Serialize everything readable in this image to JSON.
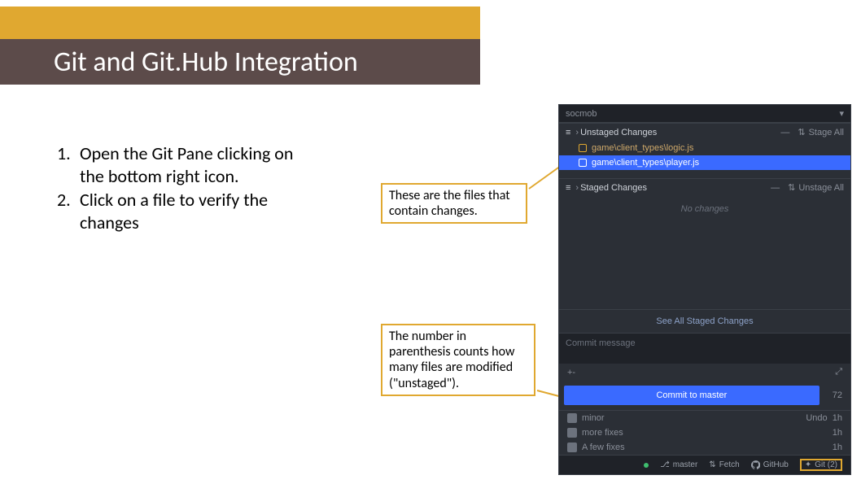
{
  "slide": {
    "title": "Git and Git.Hub Integration"
  },
  "instructions": [
    {
      "num": "1.",
      "text": "Open the Git Pane clicking on the bottom right icon."
    },
    {
      "num": "2.",
      "text": "Click on a file to verify the changes"
    }
  ],
  "callouts": {
    "files": "These are the files that contain changes.",
    "count": "The number in parenthesis counts how many files are modified (\"unstaged\")."
  },
  "git": {
    "project": "socmob",
    "sections": {
      "unstaged": {
        "label": "Unstaged Changes",
        "stage_all": "Stage All",
        "files": [
          {
            "path": "game\\client_types\\logic.js",
            "selected": false
          },
          {
            "path": "game\\client_types\\player.js",
            "selected": true
          }
        ]
      },
      "staged": {
        "label": "Staged Changes",
        "unstage_all": "Unstage All",
        "empty": "No changes"
      }
    },
    "see_all": "See All Staged Changes",
    "commit_placeholder": "Commit message",
    "amend_symbol": "+-",
    "commit_button": "Commit to master",
    "commit_count": "72",
    "recent": [
      {
        "msg": "minor",
        "meta": "Undo",
        "time": "1h"
      },
      {
        "msg": "more fixes",
        "meta": "",
        "time": "1h"
      },
      {
        "msg": "A few fixes",
        "meta": "",
        "time": "1h"
      }
    ],
    "status": {
      "branch": "master",
      "fetch": "Fetch",
      "github": "GitHub",
      "git_badge": "Git (2)"
    }
  },
  "icons": {
    "chevdown": "▾",
    "minus": "—",
    "updown": "⇅",
    "expand": "⤢",
    "branch": "⎇"
  }
}
